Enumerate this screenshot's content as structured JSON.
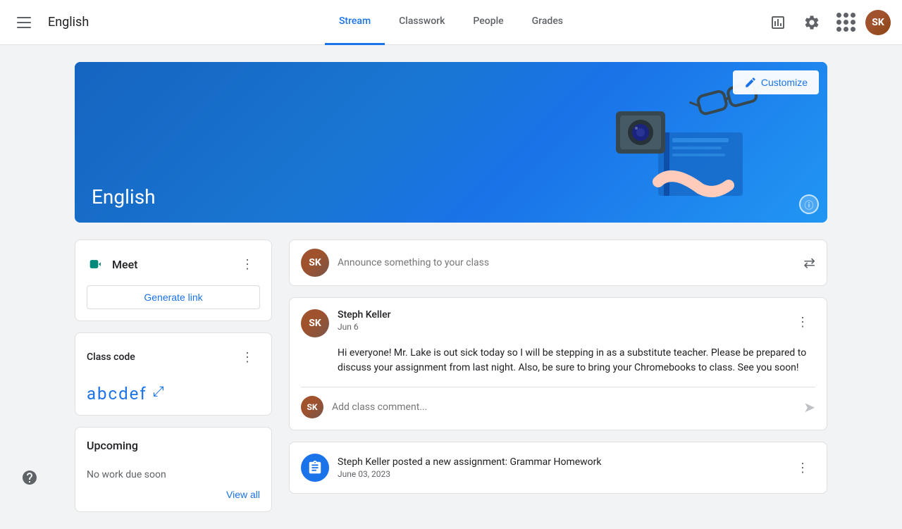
{
  "header": {
    "menu_icon": "hamburger-menu",
    "title": "English",
    "nav_tabs": [
      {
        "id": "stream",
        "label": "Stream",
        "active": true
      },
      {
        "id": "classwork",
        "label": "Classwork",
        "active": false
      },
      {
        "id": "people",
        "label": "People",
        "active": false
      },
      {
        "id": "grades",
        "label": "Grades",
        "active": false
      }
    ],
    "icons": {
      "chart": "chart-icon",
      "settings": "settings-icon",
      "apps": "apps-icon"
    }
  },
  "banner": {
    "title": "English",
    "customize_label": "Customize",
    "info_icon": "ⓘ"
  },
  "sidebar": {
    "meet": {
      "label": "Meet",
      "generate_link_label": "Generate link"
    },
    "class_code": {
      "label": "Class code",
      "value": "abcdef",
      "expand_icon": "⤢"
    },
    "upcoming": {
      "label": "Upcoming",
      "no_work_text": "No work due soon",
      "view_all_label": "View all"
    }
  },
  "stream": {
    "announce_placeholder": "Announce something to your class",
    "posts": [
      {
        "id": "post1",
        "author": "Steph Keller",
        "date": "Jun 6",
        "body": "Hi everyone! Mr. Lake is out sick today so I will be stepping in as a substitute teacher. Please be prepared to discuss your assignment from last night. Also, be sure to bring your Chromebooks to class. See you soon!",
        "comment_placeholder": "Add class comment..."
      }
    ],
    "assignments": [
      {
        "id": "assign1",
        "title": "Steph Keller posted a new assignment: Grammar Homework",
        "date": "June 03, 2023"
      }
    ]
  },
  "help": {
    "icon": "?"
  }
}
